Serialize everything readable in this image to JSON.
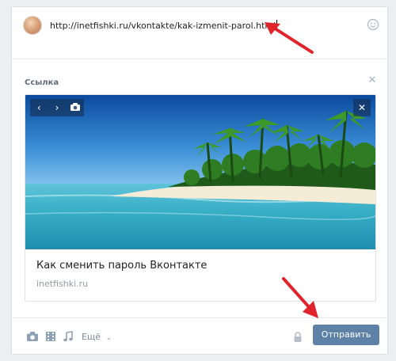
{
  "composer": {
    "url_text": "http://inetfishki.ru/vkontakte/kak-izmenit-parol.html",
    "emoji_icon": "smile-icon"
  },
  "link_attachment": {
    "section_label": "Ссылка",
    "close_icon": "close-icon",
    "photo_nav_icons": [
      "chevron-left-icon",
      "chevron-right-icon",
      "camera-icon"
    ],
    "preview_title": "Как сменить пароль Вконтакте",
    "preview_domain": "inetfishki.ru"
  },
  "toolbar": {
    "icons": [
      "camera-icon",
      "video-icon",
      "music-icon"
    ],
    "more_label": "Ещё",
    "lock_icon": "lock-icon",
    "send_label": "Отправить"
  },
  "colors": {
    "accent": "#5e81a8",
    "annotation_arrow": "#e1242b"
  }
}
